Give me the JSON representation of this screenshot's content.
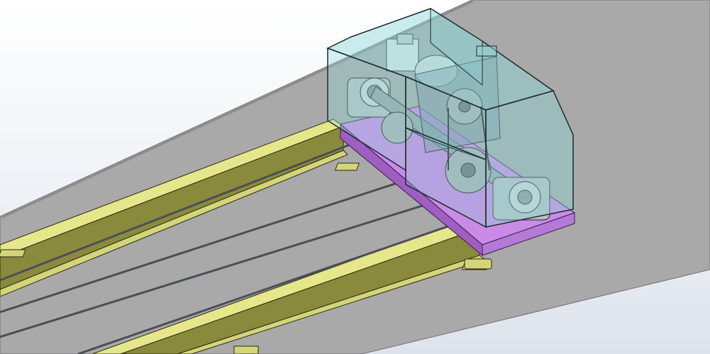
{
  "viewport": {
    "background_top": "#ffffff",
    "background_bottom": "#dde3ec"
  },
  "colors": {
    "floor": "#a9a9a9",
    "floor_edge": "#6f6f6f",
    "rail_top": "#e6e68a",
    "rail_side": "#8a8a3c",
    "rail_edge": "#2b2b10",
    "wire": "#4a4f55",
    "base_frame": "#c98be6",
    "base_frame_dark": "#9e5fc0",
    "housing_glass": "#8fd6d6",
    "housing_edge": "#1c2b2b",
    "motor": "#d9dde0",
    "bearing": "#b9c0c4",
    "sprocket": "#a9b0b4",
    "plate": "#8aa0b0"
  },
  "icons": [
    "roller-icon",
    "sprocket-icon",
    "motor-icon",
    "bearing-icon"
  ]
}
